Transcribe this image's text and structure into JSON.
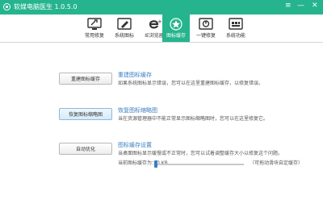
{
  "app": {
    "title": "软媒电脑医生 1.0.5.0",
    "controls": {
      "settings": "≡",
      "minimize": "—",
      "close": "✕"
    }
  },
  "tabs": [
    {
      "label": "常用修复",
      "icon": "monitor-wrench-icon",
      "active": false
    },
    {
      "label": "系统图标",
      "icon": "pen-tool-icon",
      "active": false
    },
    {
      "label": "IE浏览器",
      "icon": "ie-browser-icon",
      "active": false
    },
    {
      "label": "图标缓存",
      "icon": "star-icon",
      "active": true
    },
    {
      "label": "一键修复",
      "icon": "one-click-repair-icon",
      "active": false
    },
    {
      "label": "系统功能",
      "icon": "system-functions-icon",
      "active": false
    }
  ],
  "sections": [
    {
      "button": "重建图标缓存",
      "title": "重建图标缓存",
      "desc": "如果系统图标显示错误，您可以在这里重建图标缓存，以修复错误。"
    },
    {
      "button": "恢复图标缩略图",
      "title": "恢复图标缩略图",
      "desc": "当在资源管理器中不能正常显示图标缩略图时，您可以在这里修复它。"
    },
    {
      "button": "自动优化",
      "title": "图标缓存设置",
      "desc": "当桌面图标显示缓慢或不正常时，您可以试着调整缓存大小以修复这个问题。"
    }
  ],
  "cache_setting": {
    "label": "当前图标缓存为：0 KB",
    "hint": "（可拖动滑块自定缓存）",
    "value_kb": 0
  },
  "colors": {
    "accent": "#26b48f",
    "link": "#3a7ec2"
  }
}
